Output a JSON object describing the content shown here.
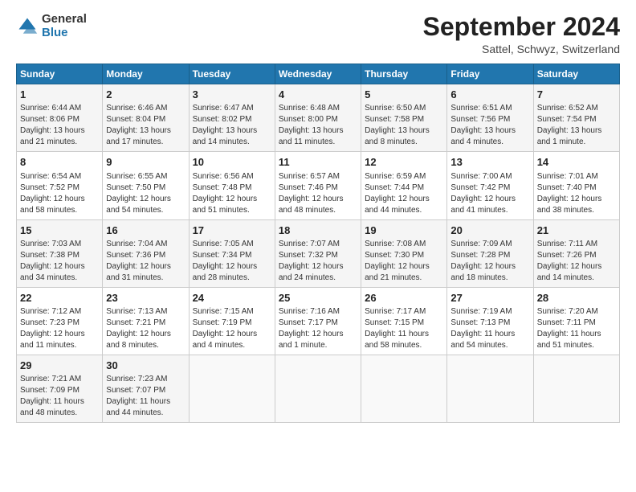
{
  "header": {
    "logo_general": "General",
    "logo_blue": "Blue",
    "month_title": "September 2024",
    "location": "Sattel, Schwyz, Switzerland"
  },
  "days_of_week": [
    "Sunday",
    "Monday",
    "Tuesday",
    "Wednesday",
    "Thursday",
    "Friday",
    "Saturday"
  ],
  "weeks": [
    [
      {
        "day": "1",
        "lines": [
          "Sunrise: 6:44 AM",
          "Sunset: 8:06 PM",
          "Daylight: 13 hours",
          "and 21 minutes."
        ]
      },
      {
        "day": "2",
        "lines": [
          "Sunrise: 6:46 AM",
          "Sunset: 8:04 PM",
          "Daylight: 13 hours",
          "and 17 minutes."
        ]
      },
      {
        "day": "3",
        "lines": [
          "Sunrise: 6:47 AM",
          "Sunset: 8:02 PM",
          "Daylight: 13 hours",
          "and 14 minutes."
        ]
      },
      {
        "day": "4",
        "lines": [
          "Sunrise: 6:48 AM",
          "Sunset: 8:00 PM",
          "Daylight: 13 hours",
          "and 11 minutes."
        ]
      },
      {
        "day": "5",
        "lines": [
          "Sunrise: 6:50 AM",
          "Sunset: 7:58 PM",
          "Daylight: 13 hours",
          "and 8 minutes."
        ]
      },
      {
        "day": "6",
        "lines": [
          "Sunrise: 6:51 AM",
          "Sunset: 7:56 PM",
          "Daylight: 13 hours",
          "and 4 minutes."
        ]
      },
      {
        "day": "7",
        "lines": [
          "Sunrise: 6:52 AM",
          "Sunset: 7:54 PM",
          "Daylight: 13 hours",
          "and 1 minute."
        ]
      }
    ],
    [
      {
        "day": "8",
        "lines": [
          "Sunrise: 6:54 AM",
          "Sunset: 7:52 PM",
          "Daylight: 12 hours",
          "and 58 minutes."
        ]
      },
      {
        "day": "9",
        "lines": [
          "Sunrise: 6:55 AM",
          "Sunset: 7:50 PM",
          "Daylight: 12 hours",
          "and 54 minutes."
        ]
      },
      {
        "day": "10",
        "lines": [
          "Sunrise: 6:56 AM",
          "Sunset: 7:48 PM",
          "Daylight: 12 hours",
          "and 51 minutes."
        ]
      },
      {
        "day": "11",
        "lines": [
          "Sunrise: 6:57 AM",
          "Sunset: 7:46 PM",
          "Daylight: 12 hours",
          "and 48 minutes."
        ]
      },
      {
        "day": "12",
        "lines": [
          "Sunrise: 6:59 AM",
          "Sunset: 7:44 PM",
          "Daylight: 12 hours",
          "and 44 minutes."
        ]
      },
      {
        "day": "13",
        "lines": [
          "Sunrise: 7:00 AM",
          "Sunset: 7:42 PM",
          "Daylight: 12 hours",
          "and 41 minutes."
        ]
      },
      {
        "day": "14",
        "lines": [
          "Sunrise: 7:01 AM",
          "Sunset: 7:40 PM",
          "Daylight: 12 hours",
          "and 38 minutes."
        ]
      }
    ],
    [
      {
        "day": "15",
        "lines": [
          "Sunrise: 7:03 AM",
          "Sunset: 7:38 PM",
          "Daylight: 12 hours",
          "and 34 minutes."
        ]
      },
      {
        "day": "16",
        "lines": [
          "Sunrise: 7:04 AM",
          "Sunset: 7:36 PM",
          "Daylight: 12 hours",
          "and 31 minutes."
        ]
      },
      {
        "day": "17",
        "lines": [
          "Sunrise: 7:05 AM",
          "Sunset: 7:34 PM",
          "Daylight: 12 hours",
          "and 28 minutes."
        ]
      },
      {
        "day": "18",
        "lines": [
          "Sunrise: 7:07 AM",
          "Sunset: 7:32 PM",
          "Daylight: 12 hours",
          "and 24 minutes."
        ]
      },
      {
        "day": "19",
        "lines": [
          "Sunrise: 7:08 AM",
          "Sunset: 7:30 PM",
          "Daylight: 12 hours",
          "and 21 minutes."
        ]
      },
      {
        "day": "20",
        "lines": [
          "Sunrise: 7:09 AM",
          "Sunset: 7:28 PM",
          "Daylight: 12 hours",
          "and 18 minutes."
        ]
      },
      {
        "day": "21",
        "lines": [
          "Sunrise: 7:11 AM",
          "Sunset: 7:26 PM",
          "Daylight: 12 hours",
          "and 14 minutes."
        ]
      }
    ],
    [
      {
        "day": "22",
        "lines": [
          "Sunrise: 7:12 AM",
          "Sunset: 7:23 PM",
          "Daylight: 12 hours",
          "and 11 minutes."
        ]
      },
      {
        "day": "23",
        "lines": [
          "Sunrise: 7:13 AM",
          "Sunset: 7:21 PM",
          "Daylight: 12 hours",
          "and 8 minutes."
        ]
      },
      {
        "day": "24",
        "lines": [
          "Sunrise: 7:15 AM",
          "Sunset: 7:19 PM",
          "Daylight: 12 hours",
          "and 4 minutes."
        ]
      },
      {
        "day": "25",
        "lines": [
          "Sunrise: 7:16 AM",
          "Sunset: 7:17 PM",
          "Daylight: 12 hours",
          "and 1 minute."
        ]
      },
      {
        "day": "26",
        "lines": [
          "Sunrise: 7:17 AM",
          "Sunset: 7:15 PM",
          "Daylight: 11 hours",
          "and 58 minutes."
        ]
      },
      {
        "day": "27",
        "lines": [
          "Sunrise: 7:19 AM",
          "Sunset: 7:13 PM",
          "Daylight: 11 hours",
          "and 54 minutes."
        ]
      },
      {
        "day": "28",
        "lines": [
          "Sunrise: 7:20 AM",
          "Sunset: 7:11 PM",
          "Daylight: 11 hours",
          "and 51 minutes."
        ]
      }
    ],
    [
      {
        "day": "29",
        "lines": [
          "Sunrise: 7:21 AM",
          "Sunset: 7:09 PM",
          "Daylight: 11 hours",
          "and 48 minutes."
        ]
      },
      {
        "day": "30",
        "lines": [
          "Sunrise: 7:23 AM",
          "Sunset: 7:07 PM",
          "Daylight: 11 hours",
          "and 44 minutes."
        ]
      },
      {
        "day": "",
        "lines": []
      },
      {
        "day": "",
        "lines": []
      },
      {
        "day": "",
        "lines": []
      },
      {
        "day": "",
        "lines": []
      },
      {
        "day": "",
        "lines": []
      }
    ]
  ]
}
